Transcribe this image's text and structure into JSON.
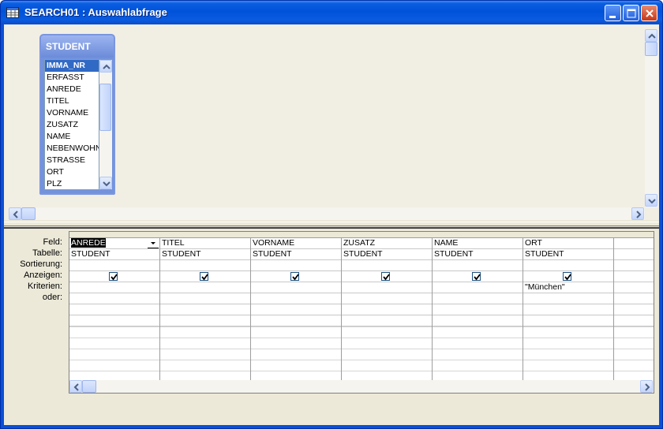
{
  "window": {
    "title": "SEARCH01 : Auswahlabfrage"
  },
  "table_box": {
    "title": "STUDENT",
    "fields": [
      "IMMA_NR",
      "ERFASST",
      "ANREDE",
      "TITEL",
      "VORNAME",
      "ZUSATZ",
      "NAME",
      "NEBENWOHN",
      "STRASSE",
      "ORT",
      "PLZ"
    ],
    "selected": "IMMA_NR"
  },
  "grid": {
    "row_labels": {
      "feld": "Feld:",
      "tabelle": "Tabelle:",
      "sortierung": "Sortierung:",
      "anzeigen": "Anzeigen:",
      "kriterien": "Kriterien:",
      "oder": "oder:"
    },
    "columns": [
      {
        "feld": "ANREDE",
        "tabelle": "STUDENT",
        "sortierung": "",
        "anzeigen": true,
        "kriterien": ""
      },
      {
        "feld": "TITEL",
        "tabelle": "STUDENT",
        "sortierung": "",
        "anzeigen": true,
        "kriterien": ""
      },
      {
        "feld": "VORNAME",
        "tabelle": "STUDENT",
        "sortierung": "",
        "anzeigen": true,
        "kriterien": ""
      },
      {
        "feld": "ZUSATZ",
        "tabelle": "STUDENT",
        "sortierung": "",
        "anzeigen": true,
        "kriterien": ""
      },
      {
        "feld": "NAME",
        "tabelle": "STUDENT",
        "sortierung": "",
        "anzeigen": true,
        "kriterien": ""
      },
      {
        "feld": "ORT",
        "tabelle": "STUDENT",
        "sortierung": "",
        "anzeigen": true,
        "kriterien": "\"München\""
      }
    ]
  },
  "icons": {
    "window": "query-icon",
    "minimize": "minimize-icon",
    "maximize": "maximize-icon",
    "close": "close-icon",
    "dropdown": "chevron-down-icon"
  },
  "colors": {
    "titlebar": "#0052d9",
    "selection": "#316ac5",
    "table_header": "#7392dc"
  }
}
